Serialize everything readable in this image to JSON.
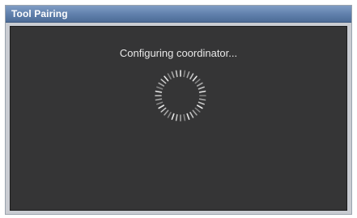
{
  "window": {
    "title": "Tool Pairing"
  },
  "content": {
    "status_text": "Configuring coordinator..."
  },
  "spinner": {
    "icon": "loading-spinner-icon",
    "color": "#e6e6e6"
  },
  "colors": {
    "titlebar": "#5f7fab",
    "content_background": "#353536"
  }
}
